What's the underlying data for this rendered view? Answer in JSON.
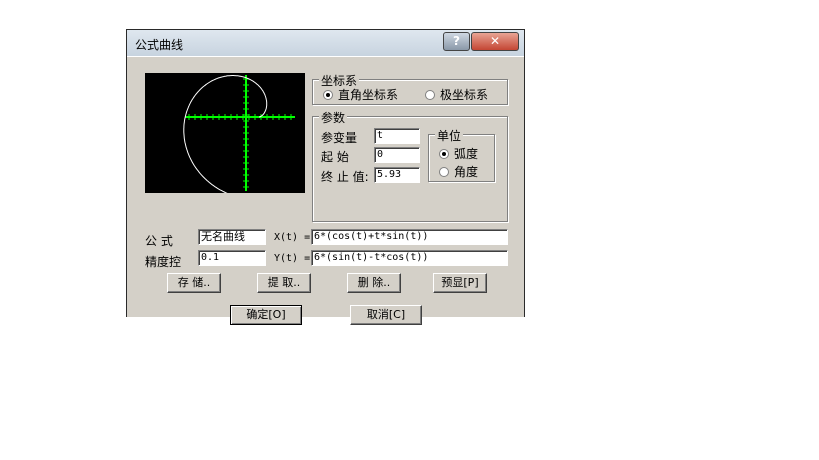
{
  "dialog": {
    "title": "公式曲线",
    "help_glyph": "?",
    "close_glyph": "✕"
  },
  "coord_system": {
    "label": "坐标系",
    "options": [
      {
        "label": "直角坐标系",
        "selected": true
      },
      {
        "label": "极坐标系",
        "selected": false
      }
    ]
  },
  "params": {
    "label": "参数",
    "variable_label": "参变量",
    "variable_value": "t",
    "start_label": "起 始",
    "start_value": "0",
    "end_label": "终 止 值:",
    "end_value": "5.93"
  },
  "unit": {
    "label": "单位",
    "options": [
      {
        "label": "弧度",
        "selected": true
      },
      {
        "label": "角度",
        "selected": false
      }
    ]
  },
  "formula": {
    "name_label": "公 式",
    "name_value": "无名曲线",
    "precision_label": "精度控",
    "precision_value": "0.1",
    "x_label": "X(t) =",
    "x_value": "6*(cos(t)+t*sin(t))",
    "y_label": "Y(t) =",
    "y_value": "6*(sin(t)-t*cos(t))"
  },
  "buttons": {
    "save": "存 储..",
    "fetch": "提 取..",
    "delete": "删 除..",
    "preview": "预显[P]",
    "ok": "确定[O]",
    "cancel": "取消[C]"
  },
  "colors": {
    "curve": "#ffffff",
    "axes": "#00ff00",
    "preview_bg": "#000000"
  }
}
